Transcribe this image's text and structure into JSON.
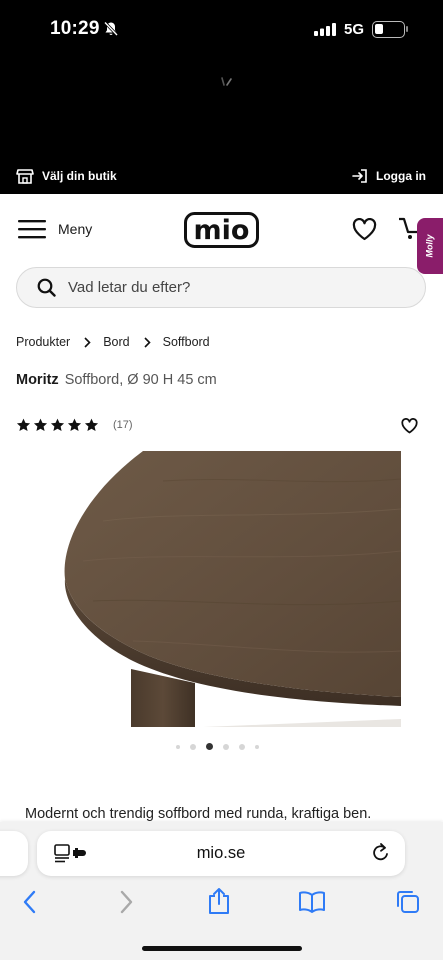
{
  "status": {
    "time": "10:29",
    "network": "5G"
  },
  "store_bar": {
    "store_label": "Välj din butik",
    "login_label": "Logga in"
  },
  "header": {
    "menu_label": "Meny",
    "logo_text": "mio",
    "chat_badge": "Molly"
  },
  "search": {
    "placeholder": "Vad letar du efter?"
  },
  "breadcrumb": [
    "Produkter",
    "Bord",
    "Soffbord"
  ],
  "product": {
    "name": "Moritz",
    "subtitle": "Soffbord, Ø 90 H 45 cm",
    "rating_stars": 5,
    "review_count": "(17)",
    "image_count": 6,
    "active_image": 3,
    "description": "Modernt och trendig soffbord med runda, kraftiga ben."
  },
  "browser": {
    "url": "mio.se"
  },
  "icons": {
    "store": "store-icon",
    "login": "login-icon",
    "menu": "hamburger-icon",
    "heart": "heart-icon",
    "cart": "cart-icon",
    "search": "search-icon",
    "chevron": "chevron-right-icon",
    "star": "star-icon",
    "back": "back-icon",
    "forward": "forward-icon",
    "share": "share-icon",
    "bookmarks": "bookmarks-icon",
    "tabs": "tabs-icon",
    "reload": "reload-icon",
    "page_menu": "page-menu-icon"
  },
  "colors": {
    "accent": "#8a1d6a",
    "ios_blue": "#2f7bf6"
  }
}
